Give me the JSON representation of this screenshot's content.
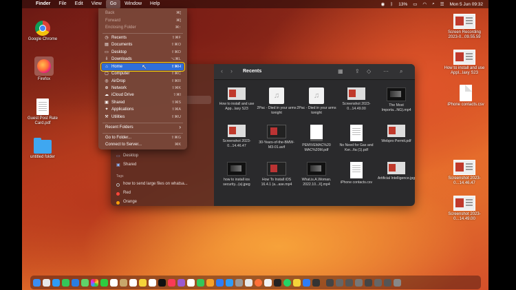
{
  "menubar": {
    "apple": "",
    "app": "Finder",
    "items": [
      "File",
      "Edit",
      "View",
      "Go",
      "Window",
      "Help"
    ],
    "battery": "13%",
    "datetime": "Mon 5 Jun  09:32"
  },
  "desktop_left": [
    {
      "label": "Google Chrome"
    },
    {
      "label": "Firefox"
    },
    {
      "label": "Guest Post Rate Card.pdf"
    },
    {
      "label": "untitled folder"
    }
  ],
  "desktop_right": [
    {
      "label": "Screen Recording 2023-0...09.55.59"
    },
    {
      "label": "How to install and use Appl...laxy S23"
    },
    {
      "label": "iPhone contacts.csv"
    },
    {
      "label": "Screenshot 2023-0...14.46.47"
    },
    {
      "label": "Screenshot 2023-0...14.49.00"
    }
  ],
  "go_menu": {
    "back": {
      "label": "Back",
      "shortcut": "⌘["
    },
    "forward": {
      "label": "Forward",
      "shortcut": "⌘]"
    },
    "enclosing": {
      "label": "Enclosing Folder",
      "shortcut": "⌘↑"
    },
    "items": [
      {
        "label": "Recents",
        "shortcut": "⇧⌘F",
        "icon": "recents-icon"
      },
      {
        "label": "Documents",
        "shortcut": "⇧⌘O",
        "icon": "documents-icon"
      },
      {
        "label": "Desktop",
        "shortcut": "⇧⌘D",
        "icon": "desktop-icon"
      },
      {
        "label": "Downloads",
        "shortcut": "⌥⌘L",
        "icon": "downloads-icon"
      },
      {
        "label": "Home",
        "shortcut": "⇧⌘H",
        "icon": "home-icon"
      },
      {
        "label": "Computer",
        "shortcut": "⇧⌘C",
        "icon": "computer-icon"
      },
      {
        "label": "AirDrop",
        "shortcut": "⇧⌘R",
        "icon": "airdrop-icon"
      },
      {
        "label": "Network",
        "shortcut": "⇧⌘K",
        "icon": "network-icon"
      },
      {
        "label": "iCloud Drive",
        "shortcut": "⇧⌘I",
        "icon": "icloud-icon"
      },
      {
        "label": "Shared",
        "shortcut": "⇧⌘S",
        "icon": "shared-icon"
      },
      {
        "label": "Applications",
        "shortcut": "⇧⌘A",
        "icon": "applications-icon"
      },
      {
        "label": "Utilities",
        "shortcut": "⇧⌘U",
        "icon": "utilities-icon"
      }
    ],
    "recent_folders": "Recent Folders",
    "recent_arrow": "›",
    "go_to_folder": {
      "label": "Go to Folder...",
      "shortcut": "⇧⌘G"
    },
    "connect": {
      "label": "Connect to Server...",
      "shortcut": "⌘K"
    }
  },
  "finder": {
    "title": "Recents",
    "sidebar": {
      "items": [
        "Desktop",
        "Shared"
      ],
      "tags_header": "Tags",
      "tags": [
        {
          "label": "how to send large files on whatsa...",
          "color": ""
        },
        {
          "label": "Red",
          "color": "#ff453a"
        },
        {
          "label": "Orange",
          "color": "#ff9f0a"
        }
      ]
    },
    "files": [
      {
        "name": "How to install and use App...laxy S23",
        "kind": "shot"
      },
      {
        "name": "2Pac - Died in your arms tonight",
        "kind": "music"
      },
      {
        "name": "2Pac - Died in your arms tonight",
        "kind": "music"
      },
      {
        "name": "Screenshot 2023-0...14.49.00",
        "kind": "shot"
      },
      {
        "name": "The Most Importa...NG).mp4",
        "kind": "vid"
      },
      {
        "name": "Screenshot 2023-0...14.46.47",
        "kind": "shot"
      },
      {
        "name": "30-Years-of-the-BMW-M3-01.avif",
        "kind": "shotdark"
      },
      {
        "name": "PEMIVEMAC%20 MAC%20M.pdf",
        "kind": "pdf2"
      },
      {
        "name": "No Need for Gas and Ker...fia (1).pdf",
        "kind": "doc"
      },
      {
        "name": "Webpro Permit.pdf",
        "kind": "shot"
      },
      {
        "name": "how to install ios security...(a).jpeg",
        "kind": "vid"
      },
      {
        "name": "How To Install iOS 16.4.1 (a...ase.mp4",
        "kind": "shotdark"
      },
      {
        "name": "What.is.A.Woman. 2022.10...X].mp4",
        "kind": "vid"
      },
      {
        "name": "iPhone contacts.csv",
        "kind": "doc"
      },
      {
        "name": "Artificial Intelligence.jpg",
        "kind": "shot"
      }
    ]
  }
}
